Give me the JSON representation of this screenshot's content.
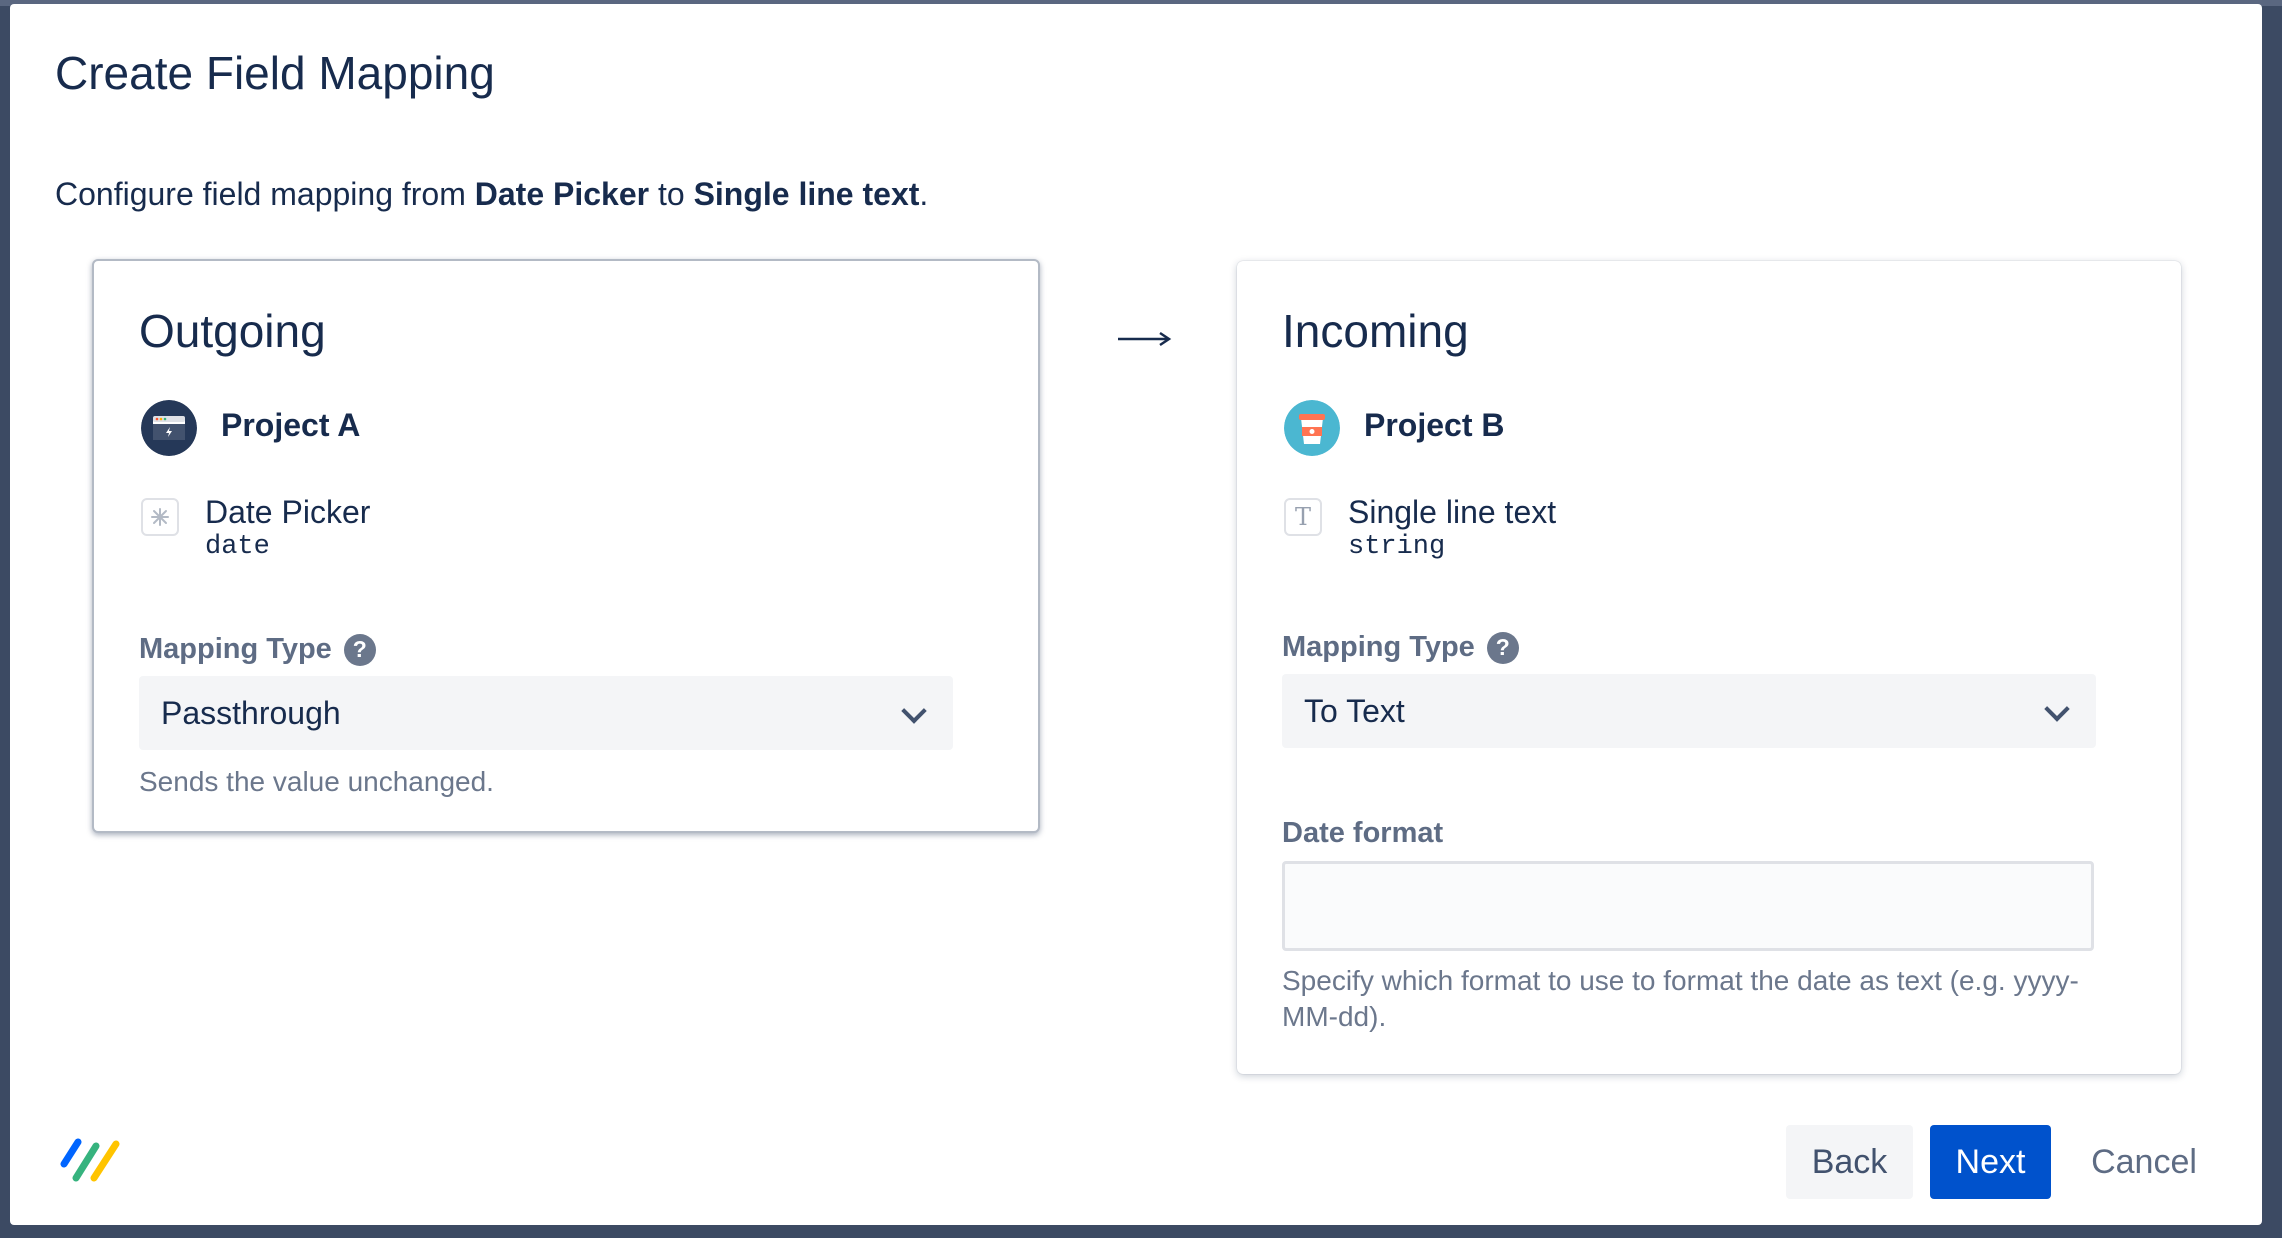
{
  "dialog": {
    "title": "Create Field Mapping",
    "description": {
      "prefix": "Configure field mapping from ",
      "source_field": "Date Picker",
      "middle": " to ",
      "target_field": "Single line text",
      "suffix": "."
    }
  },
  "outgoing": {
    "heading": "Outgoing",
    "project": "Project A",
    "project_icon": "project-a-avatar-icon",
    "field_name": "Date Picker",
    "field_type": "date",
    "field_icon": "date-picker-icon",
    "mapping_label": "Mapping Type",
    "mapping_value": "Passthrough",
    "mapping_help": "Sends the value unchanged."
  },
  "incoming": {
    "heading": "Incoming",
    "project": "Project B",
    "project_icon": "project-b-avatar-icon",
    "field_name": "Single line text",
    "field_type": "string",
    "field_icon": "text-field-icon",
    "field_icon_glyph": "T",
    "mapping_label": "Mapping Type",
    "mapping_value": "To Text",
    "date_format_label": "Date format",
    "date_format_value": "",
    "date_format_help": "Specify which format to use to format the date as text (e.g. yyyy-MM-dd)."
  },
  "arrow_glyph": "→",
  "footer": {
    "back_label": "Back",
    "next_label": "Next",
    "cancel_label": "Cancel"
  },
  "colors": {
    "primary": "#0052cc",
    "text": "#172b4d",
    "subtle": "#6b778c",
    "select_bg": "#f4f5f7",
    "backdrop": "#3c4a63"
  }
}
